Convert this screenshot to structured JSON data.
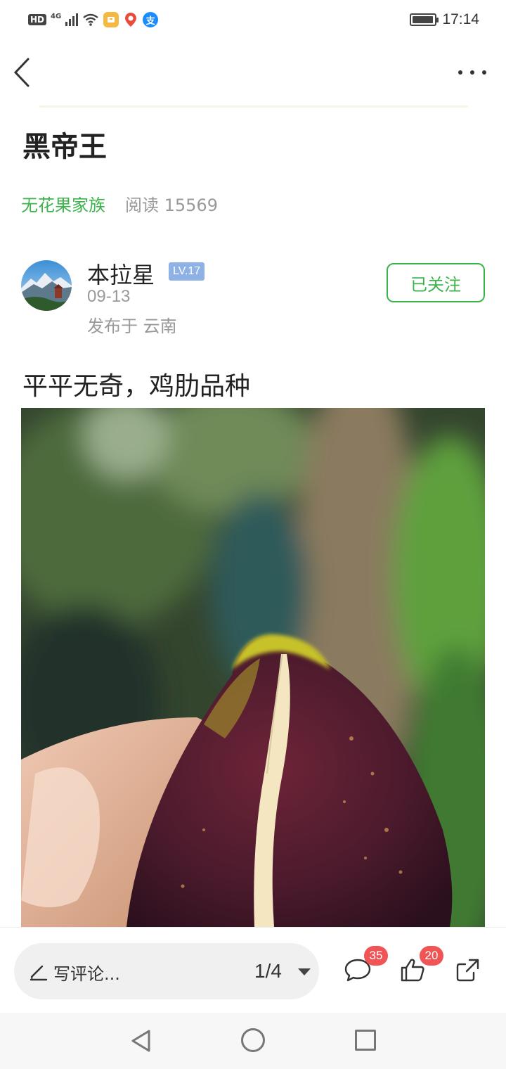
{
  "status_bar": {
    "hd": "HD",
    "network": "4G",
    "time": "17:14",
    "battery_level": 0.95,
    "app_icons": [
      "notification-app-icon",
      "location-app-icon",
      "alipay-icon"
    ],
    "alipay_glyph": "支"
  },
  "nav": {
    "back_icon": "back-chevron-icon",
    "more_icon": "more-dots-icon"
  },
  "post": {
    "title": "黑帝王",
    "group": "无花果家族",
    "reads": "阅读 15569",
    "text": "平平无奇，鸡肋品种"
  },
  "author": {
    "name": "本拉星",
    "level": "LV.17",
    "date": "09-13",
    "location": "发布于 云南",
    "follow_label": "已关注"
  },
  "toolbar": {
    "comment_placeholder": "写评论...",
    "pager": "1/4",
    "comment_count": "35",
    "like_count": "20"
  },
  "colors": {
    "accent_green": "#3cb44b",
    "badge_red": "#f05454",
    "level_blue": "#8fb2e6"
  }
}
